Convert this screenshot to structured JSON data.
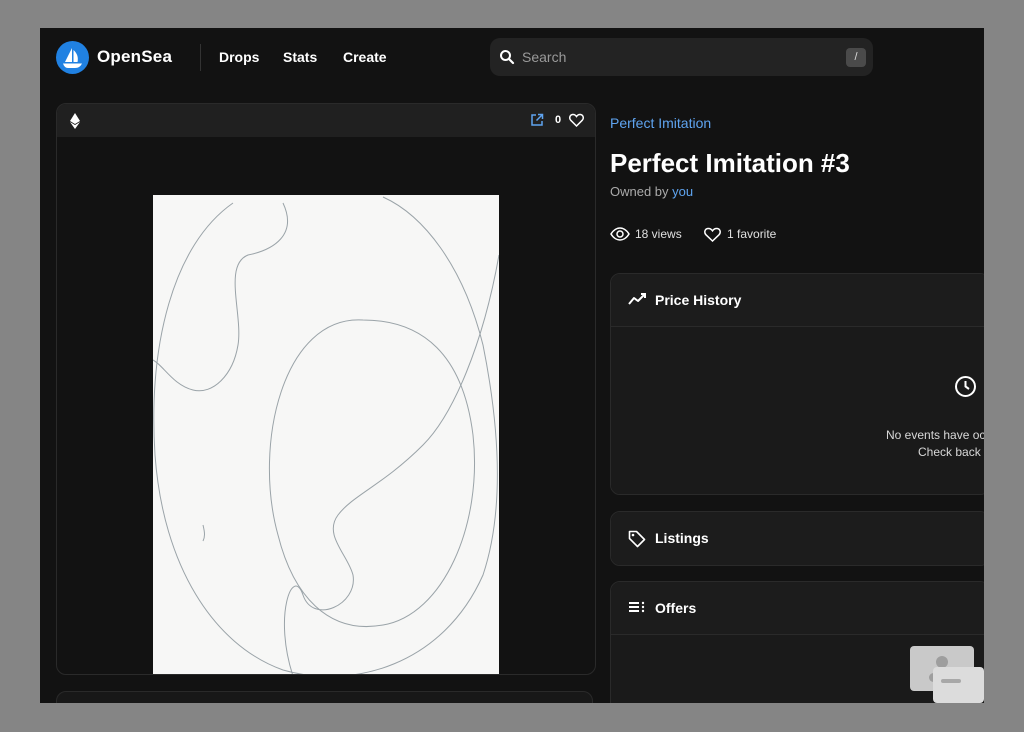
{
  "header": {
    "brand": "OpenSea",
    "nav": [
      "Drops",
      "Stats",
      "Create"
    ],
    "search_placeholder": "Search",
    "search_shortcut": "/"
  },
  "media": {
    "favorite_count": "0",
    "icons": [
      "ethereum-icon",
      "external-link-icon",
      "heart-icon"
    ]
  },
  "item": {
    "collection": "Perfect Imitation",
    "title": "Perfect Imitation #3",
    "owned_by_prefix": "Owned by",
    "owner": "you",
    "views": "18 views",
    "favorites": "1 favorite"
  },
  "panels": {
    "price_history": {
      "title": "Price History",
      "empty_line1": "No events have oc",
      "empty_line2": "Check back"
    },
    "listings": {
      "title": "Listings"
    },
    "offers": {
      "title": "Offers"
    }
  },
  "colors": {
    "background": "#121212",
    "accent_blue": "#2081e2",
    "link_blue": "#5fa4f0"
  }
}
